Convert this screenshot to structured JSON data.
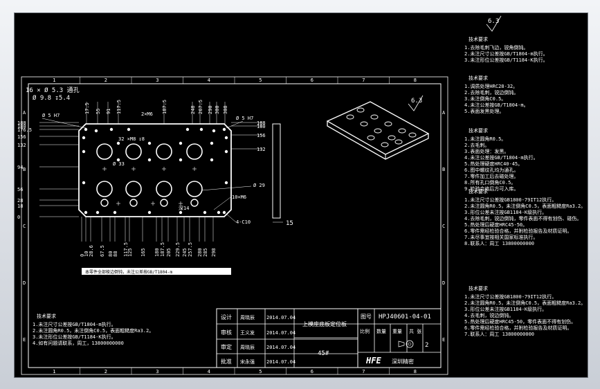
{
  "window": {
    "title": ""
  },
  "drawing": {
    "top_roughness": "6.3",
    "sheet_roughness": "6.3",
    "hole_note_1": "16 × Ø 5.3 通孔",
    "hole_note_2": "Ø 9.8 ↧5.4",
    "dowel_note": "Ø 5 H7",
    "dowel_note_right": "Ø 5 H7",
    "tap_note": "2×M6",
    "tap_note_32": "32 ×M8 ↧8",
    "dia_33": "Ø 33",
    "dia_29": "Ø 29",
    "depth_14": "深14",
    "tap_10": "10×M6",
    "chamfer": "4-C10",
    "thickness": "15",
    "top_dims": [
      "17.5",
      "55",
      "91",
      "117.5",
      "187.5",
      "248",
      "267.5",
      "290",
      "300",
      "308"
    ],
    "left_dims": [
      "188",
      "180",
      "176.5",
      "156",
      "132",
      "94",
      "56",
      "28",
      "18",
      "0"
    ],
    "right_dims": [
      "188",
      "180",
      "156",
      "132"
    ],
    "bottom_dims": [
      "0",
      "10",
      "28.6",
      "67.5",
      "80",
      "88",
      "117.5",
      "125",
      "165",
      "180",
      "187.5",
      "205",
      "229.5",
      "245",
      "257.5",
      "280",
      "285",
      "298"
    ],
    "bar_caption": "本零件全部棱边倒钝，未注公差按GB/T1804-m"
  },
  "notes": {
    "group1": {
      "title": "技术要求",
      "lines": [
        "1.去除毛刺飞边，锐角倒钝。",
        "2.未注尺寸公差按GB/T1804-m执行。",
        "3.未注形位公差按GB/T1184-K执行。"
      ]
    },
    "group2": {
      "title": "技术要求",
      "lines": [
        "1.调质处理HRC28-32。",
        "2.去除毛刺，锐边倒钝。",
        "3.未注倒角C0.5。",
        "4.未注公差按GB/T1804-m。",
        "5.表面发黑处理。"
      ]
    },
    "group3": {
      "title": "技术要求",
      "lines": [
        "1.未注圆角R0.5。",
        "2.去毛刺。",
        "3.表面处理：发黑。",
        "4.未注公差按GB/T1804-m执行。",
        "5.热处理硬度HRC40-45。",
        "6.图中螺纹孔均为通孔。",
        "7.零件加工后去磁处理。",
        "8.所有孔口倒角C0.5。",
        "9.检验合格后方可入库。"
      ]
    },
    "group4": {
      "title": "技术要求",
      "lines": [
        "1.未注尺寸公差按GB1800-79IT12执行。",
        "2.未注圆角R0.5，未注倒角C0.5，表面粗糙度Ra3.2。",
        "3.形位公差未注按GB1184-K级执行。",
        "4.去除毛刺，锐边倒钝，零件表面不得有划伤、碰伤。",
        "5.热处理后硬度HRC45-50。",
        "6.零件需经检验合格，并附检验报告及材质证明。",
        "7.未尽事宜按相关国家标准执行。",
        "8.联系人：周工 13800000000"
      ]
    },
    "group5": {
      "title": "技术要求",
      "lines": [
        "1.未注尺寸公差按GB1800-79IT12执行。",
        "2.未注圆角R0.5，未注倒角C0.5，表面粗糙度Ra3.2。",
        "3.形位公差未注按GB1184-K级执行。",
        "4.去毛刺，锐边倒钝。",
        "5.热处理后硬度HRC45-50，零件表面不得有划伤。",
        "6.零件需经检验合格，并附检验报告及材质证明。",
        "7.联系人：周工 13800000000"
      ]
    },
    "bottom_left": {
      "title": "技术要求",
      "lines": [
        "1.未注尺寸公差按GB/T1804-m执行。",
        "2.未注圆角R0.5，未注倒角C0.5，表面粗糙度Ra3.2。",
        "3.未注形位公差按GB/T1184-K执行。",
        "4.如有问题请联系，周工，13800000000"
      ]
    }
  },
  "title_block": {
    "row_labels": [
      "设计",
      "审核",
      "审定",
      "批准"
    ],
    "names": [
      "周晓辰",
      "王义发",
      "周晓辰",
      "宋永强"
    ],
    "dates": [
      "2014.07.04",
      "2014.07.04",
      "2014.07.04",
      "2014.07.04"
    ],
    "part_name": "上模座底板定位板",
    "material": "45#",
    "drawing_no_label": "图号",
    "drawing_no": "HPJ40601-04-01",
    "scale_label": "比例",
    "qty_label": "数量",
    "weight_label": "重量",
    "sheet_label": "共 张",
    "sheet_value": "2",
    "logo": "HFE",
    "company": "深圳精密"
  },
  "frame_numbers_top": [
    "1",
    "2",
    "3",
    "4",
    "5",
    "6",
    "7",
    "8"
  ],
  "frame_letters_side": [
    "A",
    "B",
    "C",
    "D",
    "E"
  ]
}
